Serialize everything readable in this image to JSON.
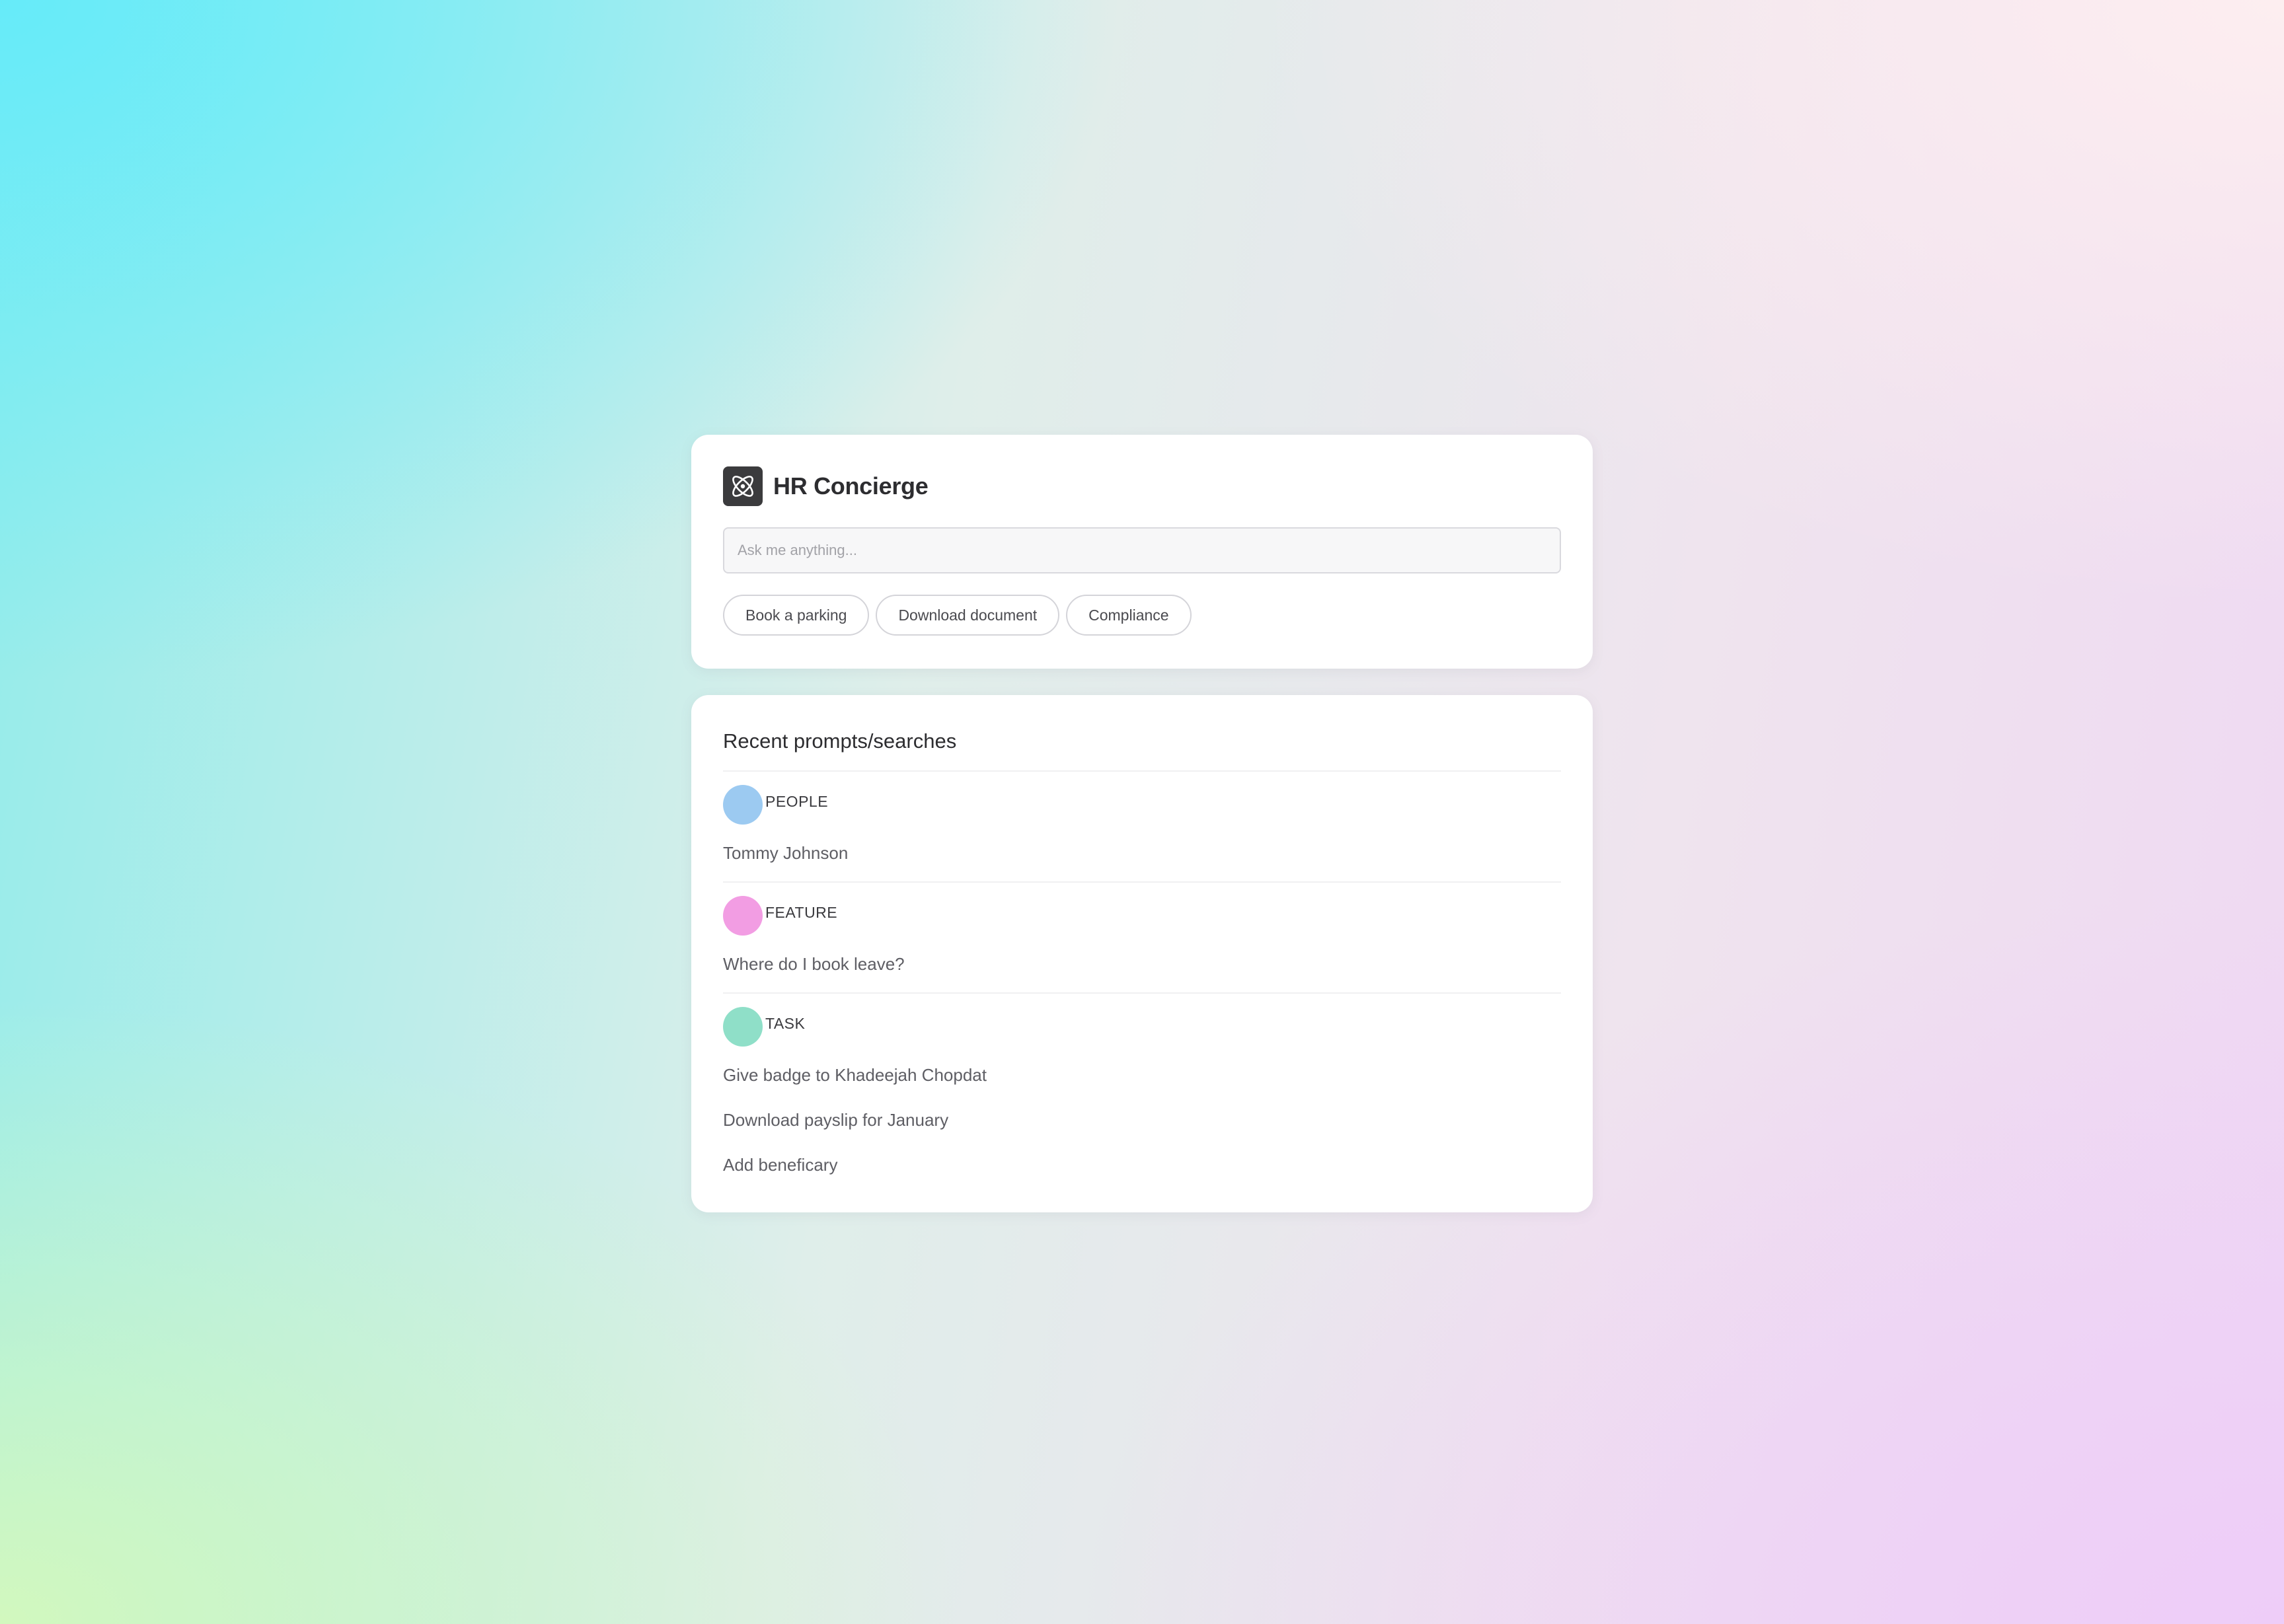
{
  "app": {
    "title": "HR Concierge",
    "logo_icon": "atom-icon"
  },
  "search": {
    "placeholder": "Ask me anything...",
    "value": ""
  },
  "quick_actions": [
    {
      "label": "Book a parking"
    },
    {
      "label": "Download document"
    },
    {
      "label": "Compliance"
    }
  ],
  "recent": {
    "title": "Recent prompts/searches",
    "groups": [
      {
        "category": "PEOPLE",
        "color": "#9ccaf1",
        "items": [
          "Tommy Johnson"
        ]
      },
      {
        "category": "FEATURE",
        "color": "#f29de3",
        "items": [
          "Where do I book leave?"
        ]
      },
      {
        "category": "TASK",
        "color": "#8fdfc8",
        "items": [
          "Give badge to Khadeejah Chopdat",
          "Download payslip for January",
          "Add beneficary"
        ]
      }
    ]
  }
}
